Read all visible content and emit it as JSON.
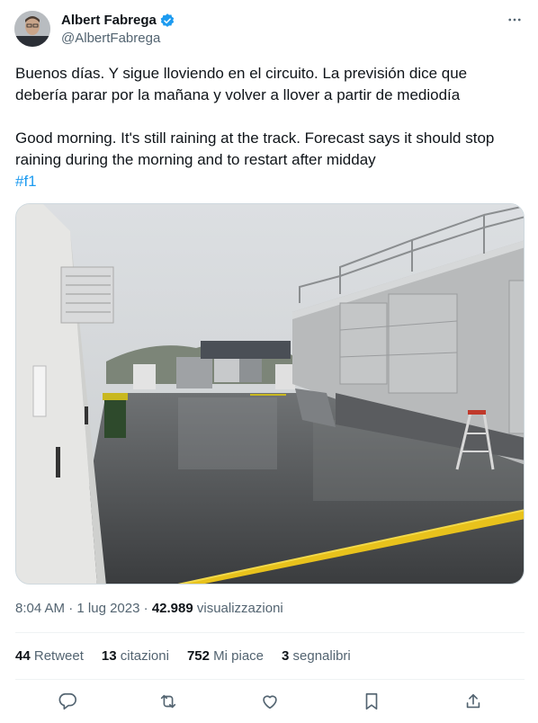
{
  "author": {
    "display_name": "Albert Fabrega",
    "handle": "@AlbertFabrega",
    "verified": true,
    "avatar_icon": "avatar-photo"
  },
  "tweet": {
    "paragraph_es": "Buenos días. Y sigue lloviendo en el circuito. La previsión dice que debería parar por la mañana y volver a llover a partir de mediodía",
    "paragraph_en": "Good morning. It's still raining at the track. Forecast says it should stop raining during the morning and to restart after midday",
    "hashtag": "#f1"
  },
  "meta": {
    "time": "8:04 AM",
    "separator": "·",
    "date": "1 lug 2023",
    "views_count": "42.989",
    "views_label": "visualizzazioni"
  },
  "stats": {
    "retweets_count": "44",
    "retweets_label": "Retweet",
    "quotes_count": "13",
    "quotes_label": "citazioni",
    "likes_count": "752",
    "likes_label": "Mi piace",
    "bookmarks_count": "3",
    "bookmarks_label": "segnalibri"
  },
  "actions": [
    "reply-icon",
    "retweet-icon",
    "like-icon",
    "bookmark-icon",
    "share-icon"
  ],
  "colors": {
    "text": "#0f1419",
    "secondary": "#536471",
    "accent": "#1d9bf0",
    "divider": "#eff3f4"
  }
}
